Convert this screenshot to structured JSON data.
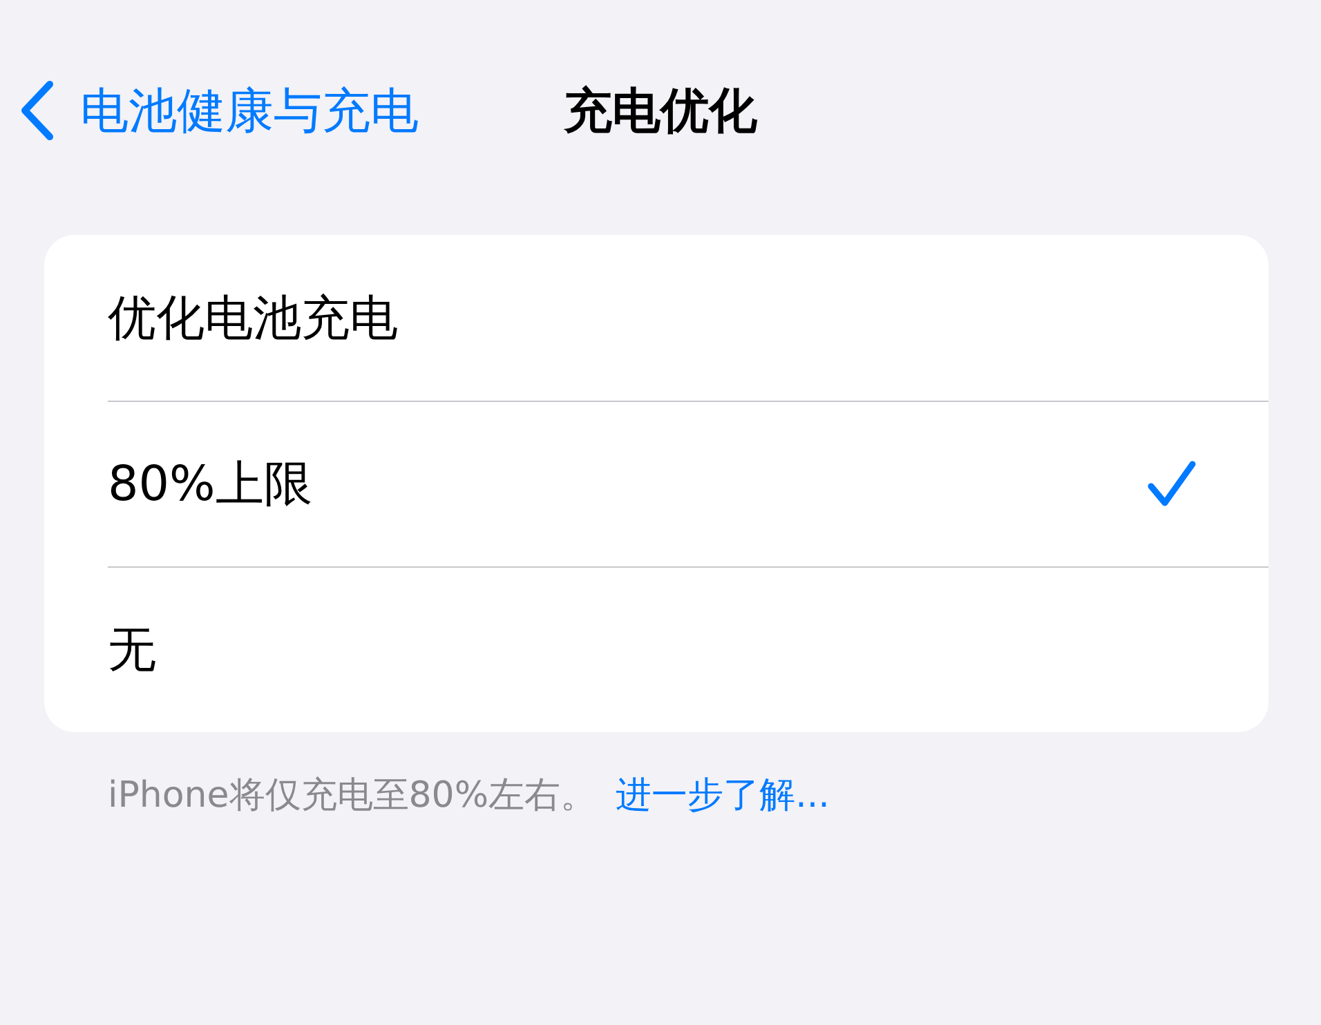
{
  "nav": {
    "back_label": "电池健康与充电",
    "title": "充电优化"
  },
  "options": [
    {
      "label": "优化电池充电",
      "selected": false
    },
    {
      "label": "80%上限",
      "selected": true
    },
    {
      "label": "无",
      "selected": false
    }
  ],
  "footer": {
    "text": "iPhone将仅充电至80%左右。",
    "link": "进一步了解..."
  }
}
